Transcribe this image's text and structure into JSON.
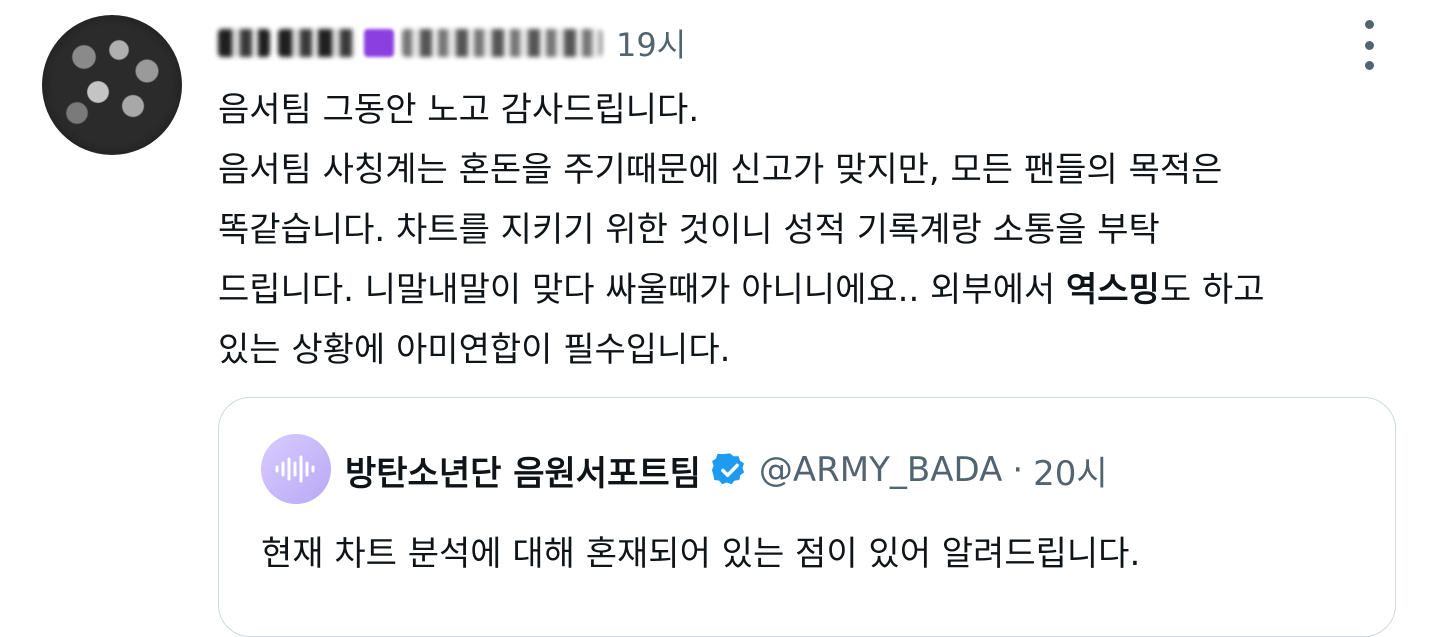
{
  "tweet": {
    "time": "19시",
    "lines": [
      "음서팀 그동안 노고 감사드립니다.",
      "음서팀 사칭계는 혼돈을 주기때문에 신고가 맞지만, 모든 팬들의 목적은",
      "똑같습니다. 차트를 지키기 위한 것이니 성적 기록계랑 소통을 부탁",
      "드립니다. 니말내말이 맞다 싸울때가 아니니에요.. 외부에서 "
    ],
    "line4_bold": "역스밍",
    "line4_after": "도 하고",
    "line5": "있는 상황에 아미연합이 필수입니다.",
    "more_icon": "more-vertical-icon"
  },
  "quote": {
    "name": "방탄소년단 음원서포트팀",
    "verified_icon": "verified-badge-icon",
    "handle": "@ARMY_BADA",
    "separator": "·",
    "time": "20시",
    "text": "현재 차트 분석에 대해 혼재되어 있는 점이 있어 알려드립니다.",
    "avatar_icon": "audio-waveform-icon",
    "accent": "#1d9bf0"
  }
}
